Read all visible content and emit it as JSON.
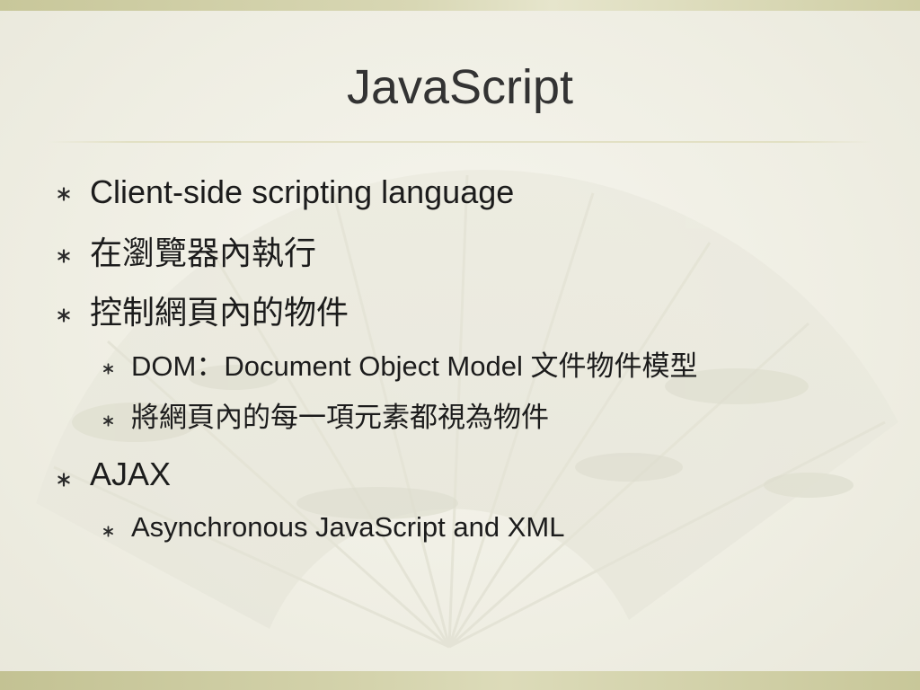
{
  "slide": {
    "title": "JavaScript",
    "bullets": [
      {
        "text": "Client-side scripting language",
        "level": 1
      },
      {
        "text": "在瀏覽器內執行",
        "level": 1
      },
      {
        "text": "控制網頁內的物件",
        "level": 1
      },
      {
        "text": "DOM：Document Object Model 文件物件模型",
        "level": 2
      },
      {
        "text": "將網頁內的每一項元素都視為物件",
        "level": 2
      },
      {
        "text": "AJAX",
        "level": 1
      },
      {
        "text": "Asynchronous JavaScript and XML",
        "level": 2
      }
    ]
  },
  "theme": {
    "bullet_icon": "asterisk-icon",
    "band_color": "#cfcea4",
    "text_color": "#1c1c1c"
  }
}
